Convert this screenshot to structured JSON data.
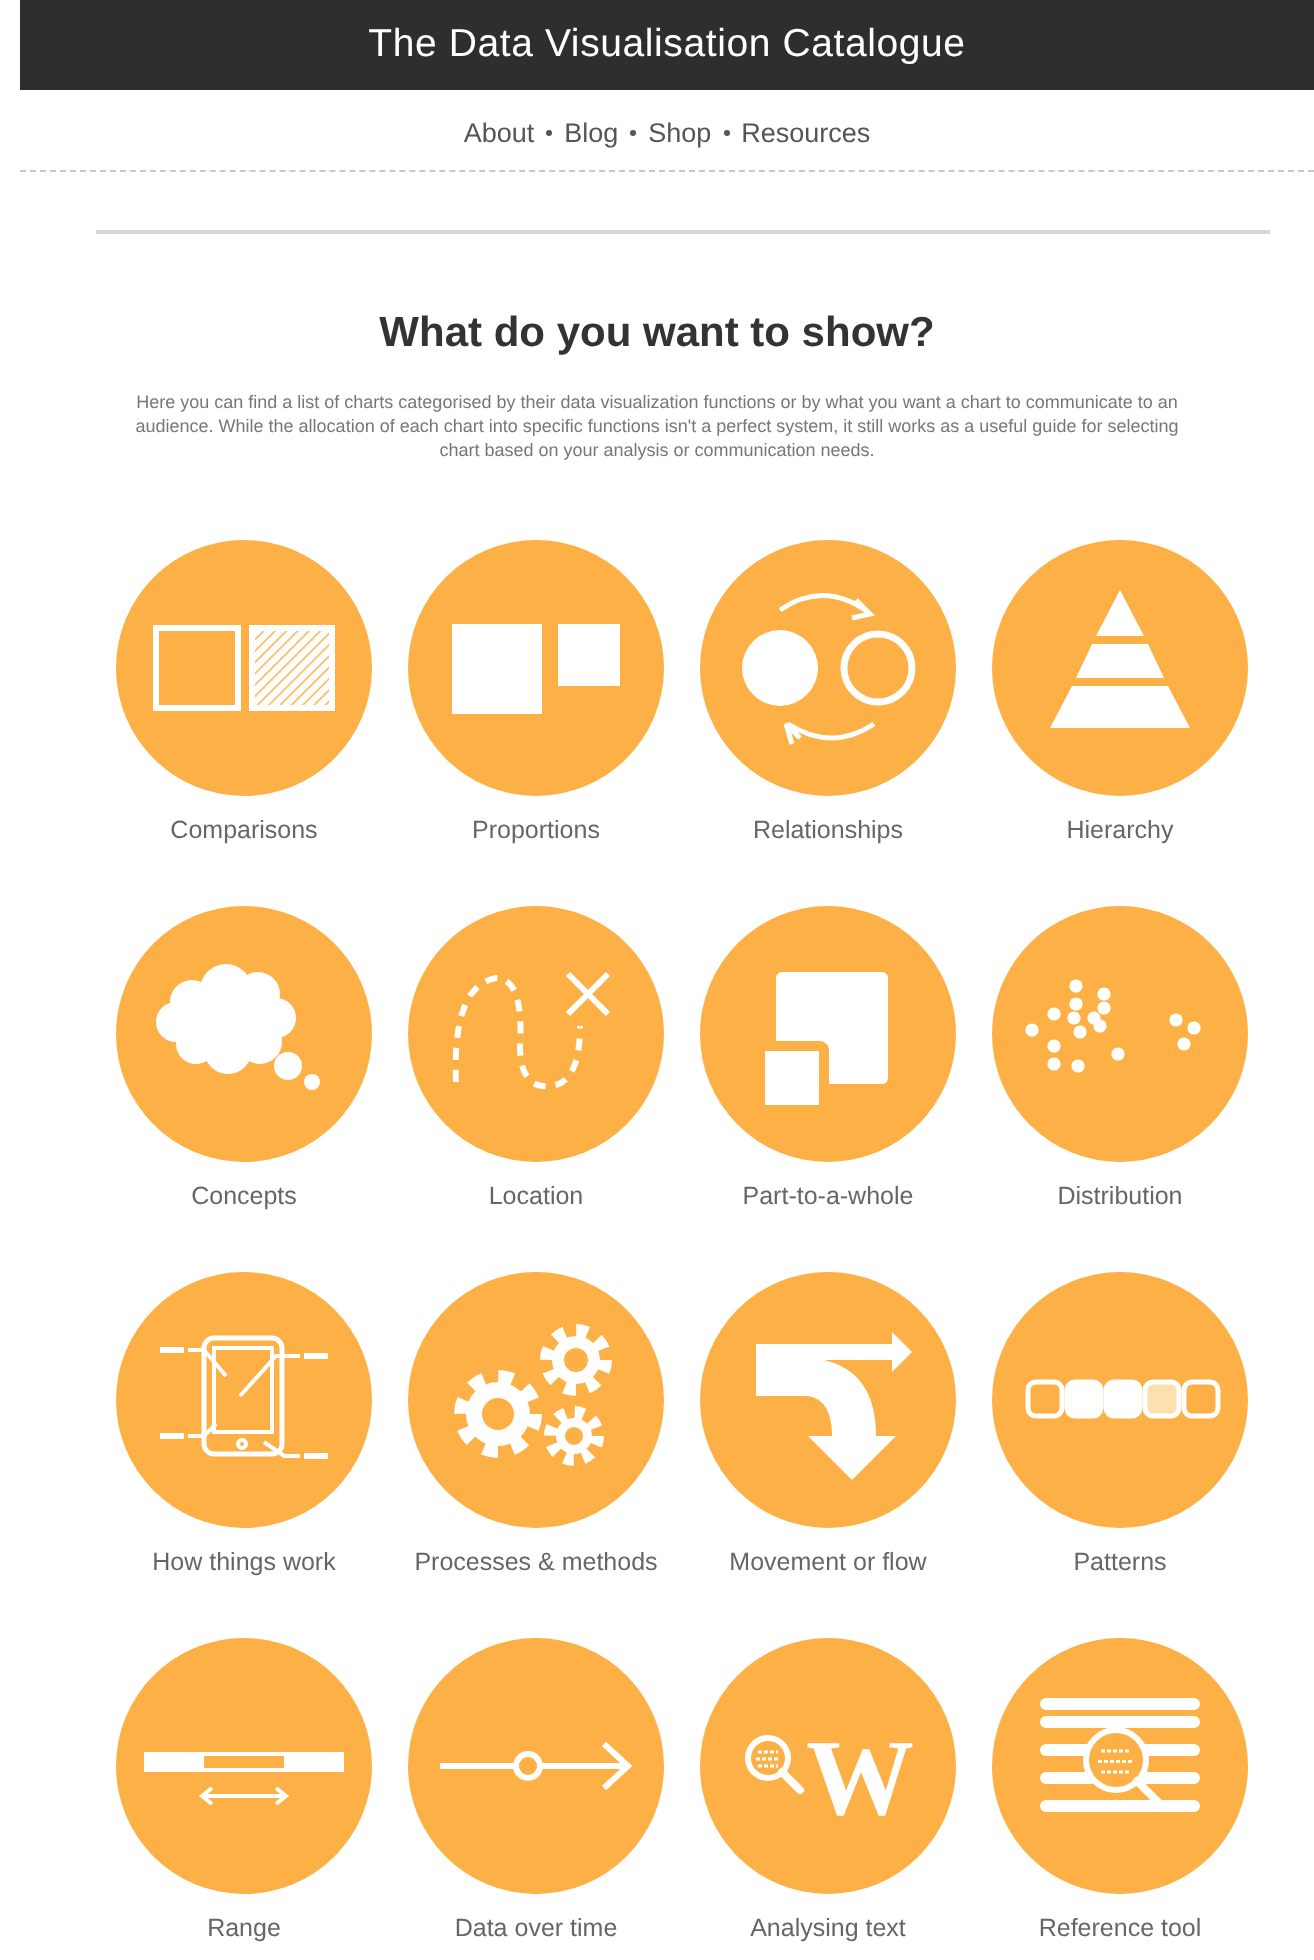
{
  "header": {
    "title": "The Data Visualisation Catalogue"
  },
  "nav": [
    "About",
    "Blog",
    "Shop",
    "Resources"
  ],
  "heading": "What do you want to show?",
  "intro": "Here you can find a list of charts categorised by their data visualization functions or by what you want a chart to communicate to an audience. While the allocation of each chart into specific functions isn't a perfect system, it still works as a useful guide for selecting chart based on your analysis or communication needs.",
  "categories": [
    {
      "label": "Comparisons",
      "kind": "comparisons"
    },
    {
      "label": "Proportions",
      "kind": "proportions"
    },
    {
      "label": "Relationships",
      "kind": "relationships"
    },
    {
      "label": "Hierarchy",
      "kind": "hierarchy"
    },
    {
      "label": "Concepts",
      "kind": "concepts"
    },
    {
      "label": "Location",
      "kind": "location"
    },
    {
      "label": "Part-to-a-whole",
      "kind": "part"
    },
    {
      "label": "Distribution",
      "kind": "distribution"
    },
    {
      "label": "How things work",
      "kind": "device"
    },
    {
      "label": "Processes & methods",
      "kind": "gears"
    },
    {
      "label": "Movement or flow",
      "kind": "flow"
    },
    {
      "label": "Patterns",
      "kind": "patterns"
    },
    {
      "label": "Range",
      "kind": "range"
    },
    {
      "label": "Data over time",
      "kind": "time"
    },
    {
      "label": "Analysing text",
      "kind": "text"
    },
    {
      "label": "Reference tool",
      "kind": "reference"
    }
  ],
  "text_icon_letter": "W"
}
